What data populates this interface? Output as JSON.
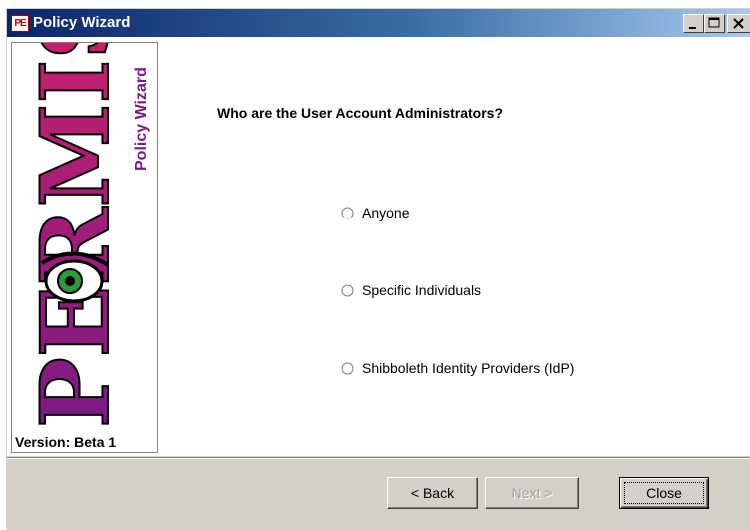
{
  "window": {
    "title": "Policy Wizard",
    "app_icon_text": "PE",
    "controls": [
      "minimize",
      "maximize",
      "close"
    ]
  },
  "logo": {
    "brand_text": "PERMIS",
    "subtitle": "Policy Wizard",
    "version": "Version: Beta 1",
    "colors": {
      "primary": "#c01a4a",
      "accent": "#7a1a86",
      "eye": "#2f9a3a"
    }
  },
  "question": "Who are the User Account Administrators?",
  "options": [
    {
      "label": "Anyone",
      "selected": false
    },
    {
      "label": "Specific Individuals",
      "selected": false
    },
    {
      "label": "Shibboleth Identity Providers (IdP)",
      "selected": false
    }
  ],
  "buttons": {
    "back": "< Back",
    "next": "Next >",
    "close": "Close"
  },
  "states": {
    "next_enabled": false
  }
}
